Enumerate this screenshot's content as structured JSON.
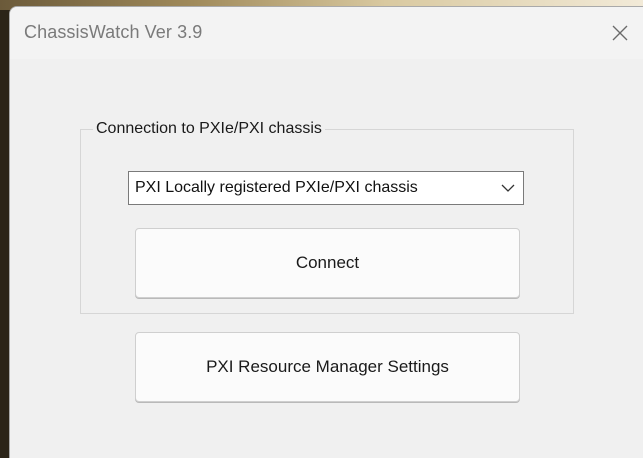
{
  "window": {
    "title": "ChassisWatch Ver 3.9"
  },
  "connection_group": {
    "legend": "Connection to PXIe/PXI chassis",
    "chassis_select": {
      "selected": "PXI Locally registered PXIe/PXI chassis"
    },
    "connect_label": "Connect"
  },
  "resource_manager_label": "PXI Resource Manager Settings",
  "icons": {
    "close": "close-icon",
    "dropdown": "chevron-down-icon"
  }
}
